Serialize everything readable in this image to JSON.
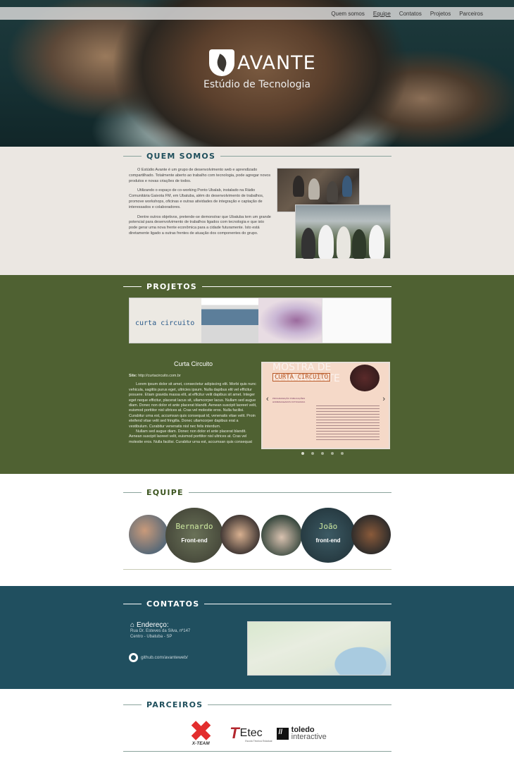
{
  "nav": {
    "items": [
      "Quem somos",
      "Equipe",
      "Contatos",
      "Projetos",
      "Parceiros"
    ],
    "active": "Equipe"
  },
  "hero": {
    "brand": "AVANTE",
    "tagline": "Estúdio de Tecnologia"
  },
  "quem_somos": {
    "title": "QUEM SOMOS",
    "paragraphs": [
      "O Estúdio Avante é um grupo de desenvolvimento web e aprendizado compartilhado. Totalmente aberto ao trabalho com tecnologia, pode agregar novos produtos e novas criações de todos.",
      "Utilizando o espaço de co-working Ponto Ubalab, instalado na Rádio Comunitária Gaivota FM, em Ubatuba, além do desenvolvimento de trabalhos, promove workshops, oficinas e outras atividades de integração e captação de interessados e colaboradores.",
      "Dentre outros objetivos, pretende-se demonstrar que Ubatuba tem um grande potencial para desenvolvimento de trabalhos ligados com tecnologia e que isto pode gerar uma nova frente econômica para a cidade futuramente. Isto está diretamente ligado a outras frentes de atuação dos componentes do grupo."
    ]
  },
  "projetos": {
    "title": "PROJETOS",
    "thumb_logo": "curta circuito",
    "project_title": "Curta Circuito",
    "site_label": "Site:",
    "site_url": "http://curtacircuito.com.br",
    "paragraphs": [
      "Lorem ipsum dolor sit amet, consectetur adipiscing elit. Morbi quis nunc vehicula, sagittis purus eget, ultricies ipsum. Nulla dapibus elit vel efficitur posuere. Etiam gravida massa elit, at efficitur velit dapibus sit amet. Integer eget neque efficitur, placerat lacus sit, ullamcorper lacus. Nullam sed augue diam. Donec non dolor et ante placerat blandit. Aenean suscipit laoreet velit, euismod porttitor nisl ultrices at. Cras vel molestie eros. Nulla facilisi. Curabitur urna est, accumsan quis consequat id, venenatis vitae velit. Proin eleifend vitae velit sed fringilla. Donec ullamcorper dapibus erat a vestibulum. Curabitur venenatis nisl nec felis interdum.",
      "Nullam sed augue diam. Donec non dolor et ante placerat blandit. Aenean suscipit laoreet velit, euismod porttitor nisl ultrices at. Cras vel molestie eros. Nulla facilisi. Curabitur urna est, accumsan quis consequat"
    ],
    "slide_big": "MOSTRA DE PERMANENTE",
    "slide_logo": "CURTA CIRCUITO",
    "slide_menu": "PROGRAMAÇÃO PUBLICAÇÕES HOMENAGEADOS FOTOGRAFIA",
    "prev_arrow": "‹",
    "next_arrow": "›",
    "dots": 5,
    "active_dot": 0
  },
  "equipe": {
    "title": "EQUIPE",
    "members": [
      {
        "name": "Bernardo",
        "role": "Front-end"
      },
      {
        "name": "João",
        "role": "front-end"
      }
    ]
  },
  "contatos": {
    "title": "CONTATOS",
    "address_label": "Endereço:",
    "address_line1": "Rua Dr. Esteves da Silva, nº147",
    "address_line2": "Centro - Ubatuba - SP",
    "github": "github.com/avanteweb/"
  },
  "parceiros": {
    "title": "PARCEIROS",
    "logos": {
      "xteam": "X-TEAM",
      "etec": "Etec",
      "etec_sub": "Escola Técnica Estadual",
      "toledo1": "toledo",
      "toledo2": "interactive"
    }
  }
}
